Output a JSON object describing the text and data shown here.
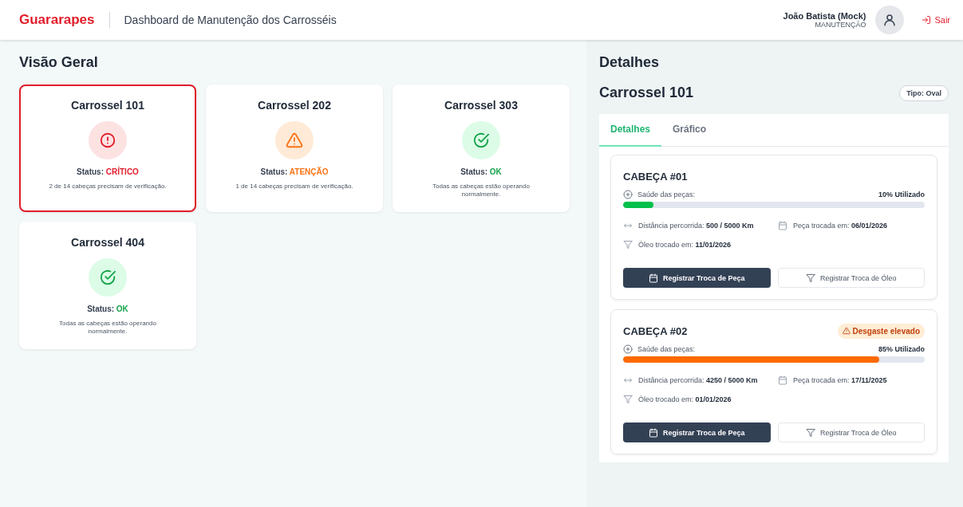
{
  "header": {
    "brand": "Guararapes",
    "title": "Dashboard de Manutenção dos Carrosséis",
    "user_name": "João Batista (Mock)",
    "user_role": "MANUTENÇÃO",
    "logout": "Sair"
  },
  "overview": {
    "title": "Visão Geral",
    "carousels": [
      {
        "name": "Carrossel 101",
        "kind": "critical",
        "status_label": "Status:",
        "status_value": "CRÍTICO",
        "description": "2 de 14 cabeças precisam de verificação.",
        "selected": true
      },
      {
        "name": "Carrossel 202",
        "kind": "warning",
        "status_label": "Status:",
        "status_value": "ATENÇÃO",
        "description": "1 de 14 cabeças precisam de verificação.",
        "selected": false
      },
      {
        "name": "Carrossel 303",
        "kind": "ok",
        "status_label": "Status:",
        "status_value": "OK",
        "description": "Todas as cabeças estão operando normalmente.",
        "selected": false
      },
      {
        "name": "Carrossel 404",
        "kind": "ok",
        "status_label": "Status:",
        "status_value": "OK",
        "description": "Todas as cabeças estão operando normalmente.",
        "selected": false
      }
    ]
  },
  "details": {
    "title": "Detalhes",
    "carousel_name": "Carrossel 101",
    "type_badge": "Tipo: Oval",
    "tabs": [
      {
        "label": "Detalhes",
        "selected": true
      },
      {
        "label": "Gráfico",
        "selected": false
      }
    ],
    "heads": [
      {
        "name": "CABEÇA #01",
        "health_label": "Saúde das peças:",
        "usage": "10% Utilizado",
        "level": 0.1,
        "kind": "ok",
        "distance_label": "Distância percorrida:",
        "distance_value": "500 / 5000 Km",
        "part_label": "Peça trocada em:",
        "part_value": "06/01/2026",
        "oil_label": "Óleo trocado em:",
        "oil_value": "11/01/2026",
        "part_button": "Registrar Troca de Peça",
        "oil_button": "Registrar Troca de Óleo"
      },
      {
        "name": "CABEÇA #02",
        "badge": "Desgaste elevado",
        "health_label": "Saúde das peças:",
        "usage": "85% Utilizado",
        "level": 0.85,
        "kind": "warning",
        "distance_label": "Distância percorrida:",
        "distance_value": "4250 / 5000 Km",
        "part_label": "Peça trocada em:",
        "part_value": "17/11/2025",
        "oil_label": "Óleo trocado em:",
        "oil_value": "01/01/2026",
        "part_button": "Registrar Troca de Peça",
        "oil_button": "Registrar Troca de Óleo"
      }
    ]
  }
}
